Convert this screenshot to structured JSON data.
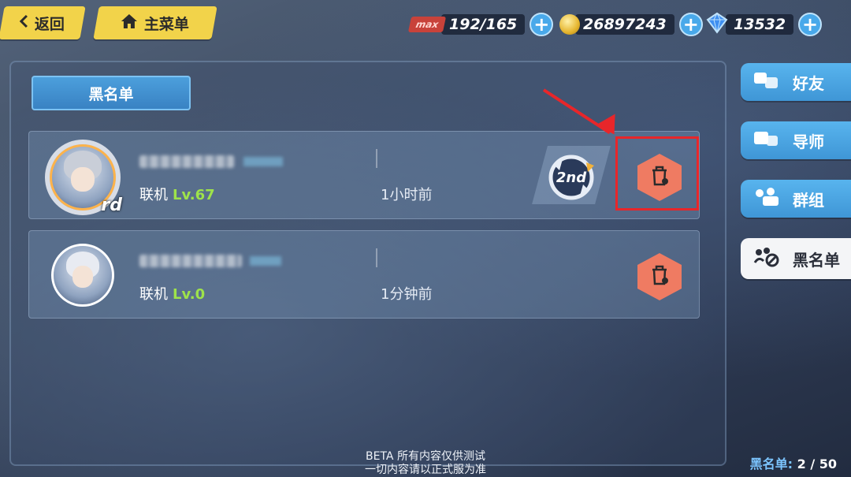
{
  "nav": {
    "back_label": "返回",
    "home_label": "主菜单"
  },
  "resources": {
    "stamina": "192/165",
    "stamina_tag": "max",
    "coins": "26897243",
    "crystals": "13532",
    "plus": "+"
  },
  "panel": {
    "title": "黑名单"
  },
  "blacklist": [
    {
      "status": "联机",
      "level": "Lv.67",
      "time": "1小时前",
      "rank_badge": "2nd",
      "avatar_tag": "rd"
    },
    {
      "status": "联机",
      "level": "Lv.0",
      "time": "1分钟前"
    }
  ],
  "side_tabs": [
    {
      "label": "好友"
    },
    {
      "label": "导师"
    },
    {
      "label": "群组"
    },
    {
      "label": "黑名单"
    }
  ],
  "footer": {
    "beta_line1": "BETA 所有内容仅供测试",
    "beta_line2": "一切内容请以正式服为准",
    "count_label": "黑名单:",
    "count_value": "2 / 50"
  },
  "colors": {
    "accent_yellow": "#f2d34a",
    "accent_blue": "#4aa8ea",
    "delete_orange": "#ef7b62",
    "level_green": "#9ee34a",
    "annotation_red": "#e8262a"
  }
}
